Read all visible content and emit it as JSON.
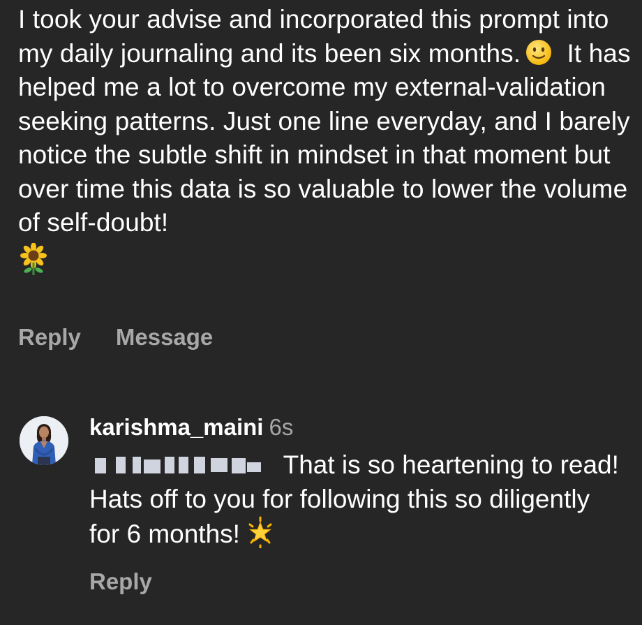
{
  "comment": {
    "text_part1": "I took your advise and incorporated this prompt into my daily journaling and its been six months.",
    "smiley_icon": "slightly-smiling-face-emoji",
    "text_part2": "It has helped me a lot to overcome my external-validation seeking patterns. Just one line everyday, and I barely notice the subtle shift in mindset in that moment but over time this data is so valuable to lower the volume of self-doubt!",
    "trailing_icon": "sunflower-emoji",
    "actions": {
      "reply_label": "Reply",
      "message_label": "Message"
    }
  },
  "reply": {
    "username": "karishma_maini",
    "timestamp": "6s",
    "text": "That is so heartening to read! Hats off to you for following this so diligently for 6 months!",
    "trailing_icon": "glowing-star-emoji",
    "reply_label": "Reply"
  },
  "colors": {
    "background": "#262626",
    "primary_text": "#ffffff",
    "secondary_text": "#a8a8a8"
  }
}
